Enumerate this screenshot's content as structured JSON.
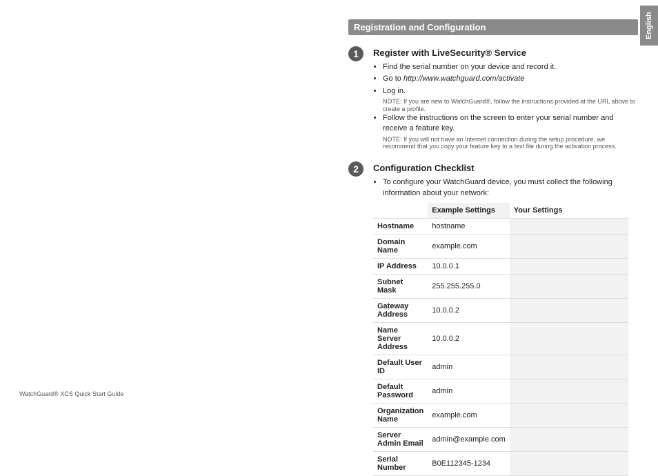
{
  "language_tab": "English",
  "header": "Registration and Configuration",
  "step1": {
    "number": "1",
    "title": "Register with LiveSecurity® Service",
    "bullet1": "Find the serial number on your device and record it.",
    "bullet2_prefix": "Go to ",
    "bullet2_url": "http://www.watchguard.com/activate",
    "bullet3": "Log in.",
    "note1": "NOTE: If you are new to WatchGuard®, follow the instructions provided at the URL above to create a profile.",
    "bullet4": "Follow the instructions on the screen to enter your serial number and receive a feature key.",
    "note2": "NOTE: If you will not have an Internet connection during the setup procedure, we recommend that you copy your feature key to a text file during the activation process."
  },
  "step2": {
    "number": "2",
    "title": "Configuration Checklist",
    "intro": "To configure your WatchGuard device, you must collect the following information about your network:"
  },
  "table": {
    "headers": {
      "blank": "",
      "example": "Example Settings",
      "your": "Your Settings"
    },
    "rows": [
      {
        "label": "Hostname",
        "example": "hostname",
        "your": ""
      },
      {
        "label": "Domain Name",
        "example": "example.com",
        "your": ""
      },
      {
        "label": "IP Address",
        "example": "10.0.0.1",
        "your": ""
      },
      {
        "label": "Subnet Mask",
        "example": "255.255.255.0",
        "your": ""
      },
      {
        "label": "Gateway Address",
        "example": "10.0.0.2",
        "your": ""
      },
      {
        "label": "Name Server Address",
        "example": "10.0.0.2",
        "your": ""
      },
      {
        "label": "Default User ID",
        "example": "admin",
        "your": ""
      },
      {
        "label": "Default Password",
        "example": "admin",
        "your": ""
      },
      {
        "label": "Organization Name",
        "example": "example.com",
        "your": ""
      },
      {
        "label": "Server Admin Email",
        "example": "admin@example.com",
        "your": ""
      },
      {
        "label": "Serial Number",
        "example": "B0E112345-1234",
        "your": ""
      }
    ]
  },
  "footer": "WatchGuard® XCS Quick Start Guide"
}
